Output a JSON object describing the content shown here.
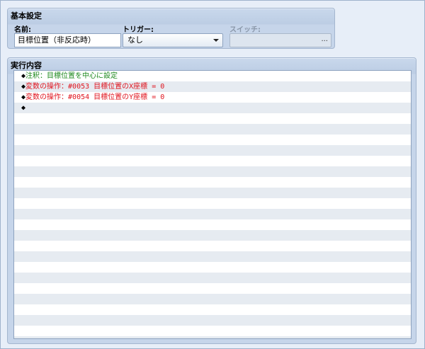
{
  "basic_settings": {
    "title": "基本設定",
    "name_label": "名前:",
    "name_value": "目標位置（非反応時）",
    "trigger_label": "トリガー:",
    "trigger_value": "なし",
    "switch_label": "スイッチ:",
    "switch_button": "..."
  },
  "contents": {
    "title": "実行内容",
    "rows": [
      {
        "marker": "◆",
        "text": "注釈：目標位置を中心に設定",
        "kind": "comment"
      },
      {
        "marker": "◆",
        "text": "変数の操作：#0053 目標位置のX座標 = 0",
        "kind": "variable"
      },
      {
        "marker": "◆",
        "text": "変数の操作：#0054 目標位置のY座標 = 0",
        "kind": "variable"
      },
      {
        "marker": "◆",
        "text": "",
        "kind": "empty"
      }
    ]
  },
  "colors": {
    "comment": "#1f8a1f",
    "variable": "#e0141e"
  },
  "icons": {
    "trigger_dropdown": "chevron-down-icon",
    "row_marker": "diamond-icon"
  }
}
